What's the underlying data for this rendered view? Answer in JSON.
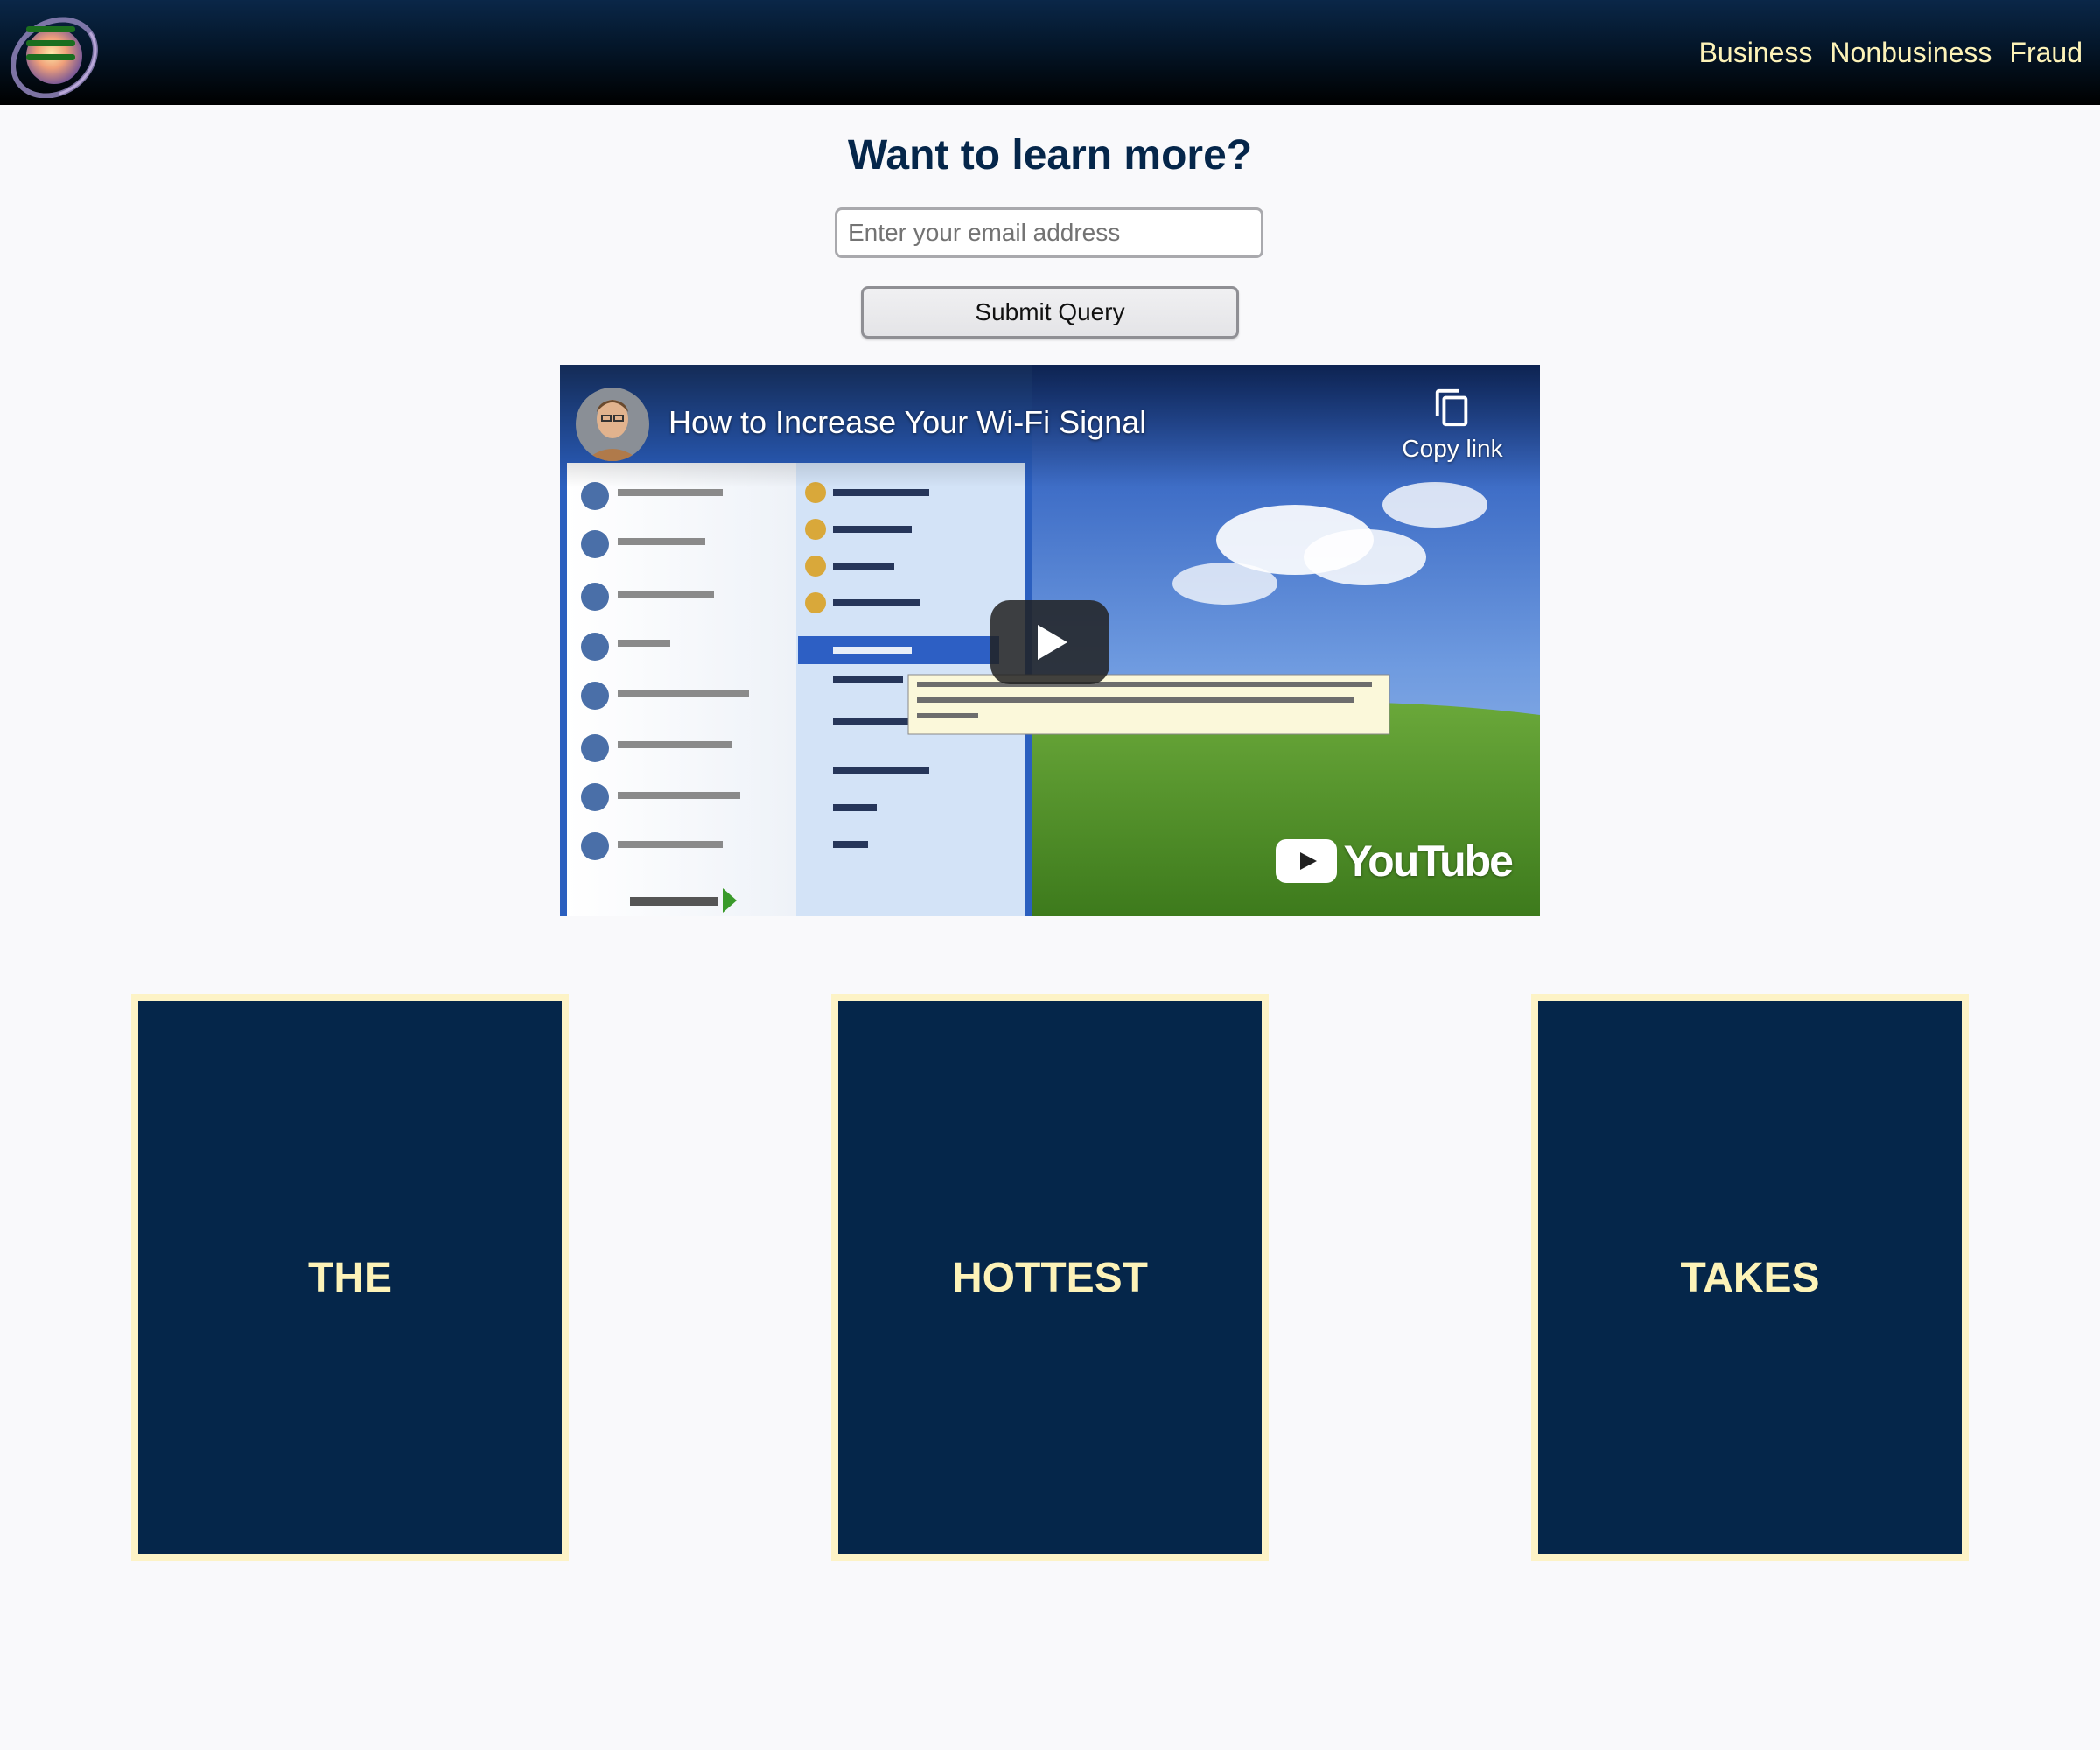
{
  "header": {
    "logo_icon": "planet-ring-menu-icon",
    "nav": [
      {
        "label": "Business"
      },
      {
        "label": "Nonbusiness"
      },
      {
        "label": "Fraud"
      }
    ]
  },
  "signup": {
    "heading": "Want to learn more?",
    "email_placeholder": "Enter your email address",
    "submit_label": "Submit Query"
  },
  "video": {
    "title": "How to Increase Your Wi-Fi Signal",
    "copy_link_label": "Copy link",
    "brand": "YouTube",
    "play_icon": "play-icon"
  },
  "cards": [
    {
      "label": "THE"
    },
    {
      "label": "HOTTEST"
    },
    {
      "label": "TAKES"
    }
  ],
  "colors": {
    "navy": "#05264a",
    "cream": "#fdf3b8",
    "page_bg": "#f9f9fb"
  }
}
